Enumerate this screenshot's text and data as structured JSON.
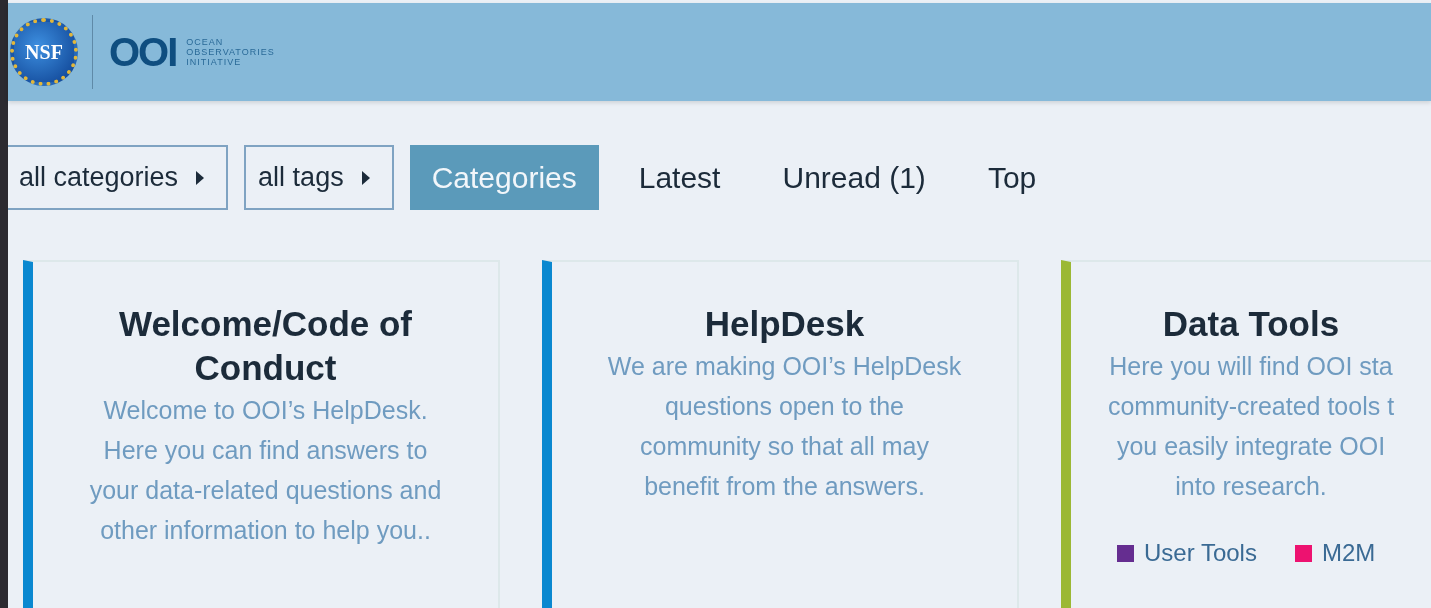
{
  "header": {
    "seal_text": "NSF",
    "logo_text": "OOI",
    "logo_caption": [
      "OCEAN",
      "OBSERVATORIES",
      "INITIATIVE"
    ]
  },
  "filters": [
    {
      "label": "all categories"
    },
    {
      "label": "all tags"
    }
  ],
  "tabs": [
    {
      "label": "Categories",
      "selected": true
    },
    {
      "label": "Latest",
      "selected": false
    },
    {
      "label": "Unread (1)",
      "selected": false
    },
    {
      "label": "Top",
      "selected": false
    }
  ],
  "categories": [
    {
      "title": "Welcome/Code of Conduct",
      "color": "#0a88d0",
      "description": [
        "Welcome to OOI’s HelpDesk.",
        "Here you can find answers to",
        "your data-related questions and",
        "other information to help you.."
      ]
    },
    {
      "title": "HelpDesk",
      "color": "#0a88d0",
      "description": [
        "We are making OOI’s HelpDesk",
        "questions open to the",
        "community so that all may",
        "benefit from the answers."
      ]
    },
    {
      "title": "Data Tools",
      "color": "#9bb834",
      "description": [
        "Here you will find OOI sta",
        "community-created tools t",
        "you easily integrate OOI",
        "into research."
      ],
      "subcategories": [
        {
          "name": "User Tools",
          "color": "#652d90"
        },
        {
          "name": "M2M",
          "color": "#ed1270"
        }
      ]
    }
  ]
}
